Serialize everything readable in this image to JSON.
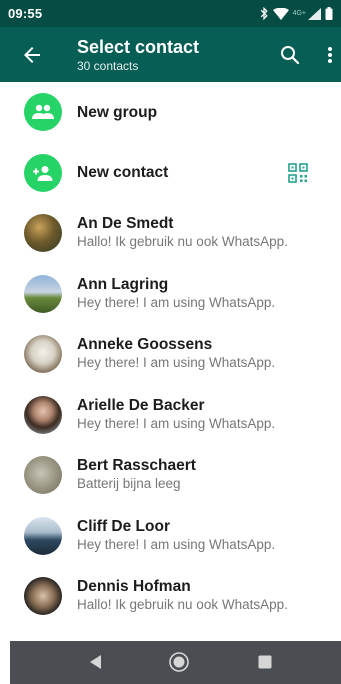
{
  "status_bar": {
    "time": "09:55",
    "network_label": "4G+",
    "icons": [
      "bluetooth-icon",
      "wifi-icon",
      "signal-icon",
      "battery-icon"
    ]
  },
  "app_bar": {
    "title": "Select contact",
    "subtitle": "30 contacts",
    "icons": [
      "back-arrow-icon",
      "search-icon",
      "more-vert-icon"
    ]
  },
  "actions": [
    {
      "label": "New group",
      "icon": "group-add-icon"
    },
    {
      "label": "New contact",
      "icon": "person-add-icon",
      "trailing_icon": "qr-code-icon"
    }
  ],
  "contacts": [
    {
      "name": "An De Smedt",
      "status": "Hallo! Ik gebruik nu ook WhatsApp."
    },
    {
      "name": "Ann Lagring",
      "status": "Hey there! I am using WhatsApp."
    },
    {
      "name": "Anneke Goossens",
      "status": "Hey there! I am using WhatsApp."
    },
    {
      "name": "Arielle De Backer",
      "status": "Hey there! I am using WhatsApp."
    },
    {
      "name": "Bert Rasschaert",
      "status": "Batterij bijna leeg"
    },
    {
      "name": "Cliff De Loor",
      "status": "Hey there! I am using WhatsApp."
    },
    {
      "name": "Dennis Hofman",
      "status": "Hallo! Ik gebruik nu ook WhatsApp."
    }
  ],
  "nav_bar": {
    "icons": [
      "back-triangle-icon",
      "home-circle-icon",
      "recents-square-icon"
    ]
  },
  "colors": {
    "status_bar": "#054d44",
    "app_bar": "#075e54",
    "accent_green": "#25d366",
    "qr_icon": "#25a18e",
    "nav_bar": "#4a4e52"
  }
}
